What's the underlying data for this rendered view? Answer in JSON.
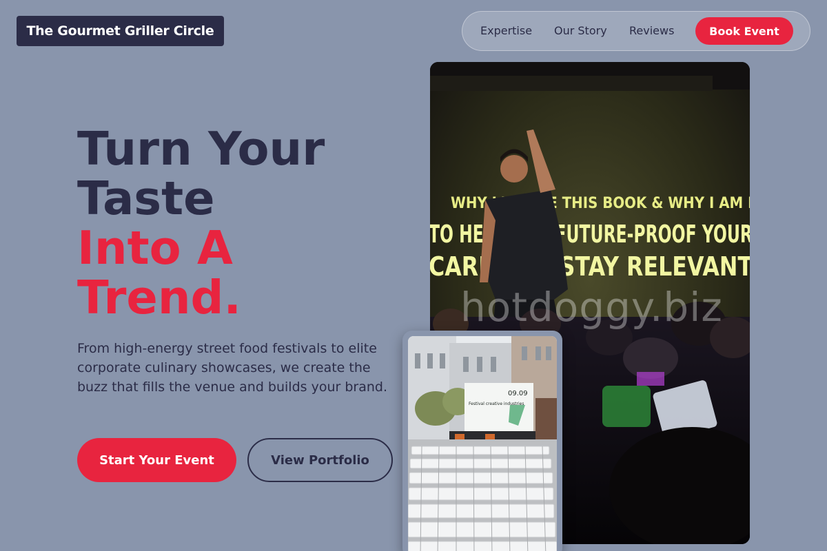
{
  "brand": {
    "name": "The Gourmet Griller Circle"
  },
  "nav": {
    "links": [
      "Expertise",
      "Our Story",
      "Reviews"
    ],
    "cta": "Book Event"
  },
  "hero": {
    "headline_lines": [
      "Turn Your",
      "Taste"
    ],
    "headline_accent_lines": [
      "Into A",
      "Trend."
    ],
    "subtext": "From high-energy street food festivals to elite corporate culinary showcases, we create the buzz that fills the venue and builds your brand.",
    "primary_cta": "Start Your Event",
    "secondary_cta": "View Portfolio"
  },
  "main_photo": {
    "screen_line_1": "WHY I WROTE THIS BOOK & WHY I AM HERE...",
    "screen_line_2": "TO HELP YOU FUTURE-PROOF YOUR",
    "screen_line_3": "CAREER & STAY RELEVANT",
    "watermark": "hotdoggy.biz"
  },
  "small_photo": {
    "board_date": "09.09",
    "board_title": "Festival creative industries"
  },
  "colors": {
    "background": "#8995ac",
    "dark": "#2b2c47",
    "accent": "#e8243f"
  }
}
